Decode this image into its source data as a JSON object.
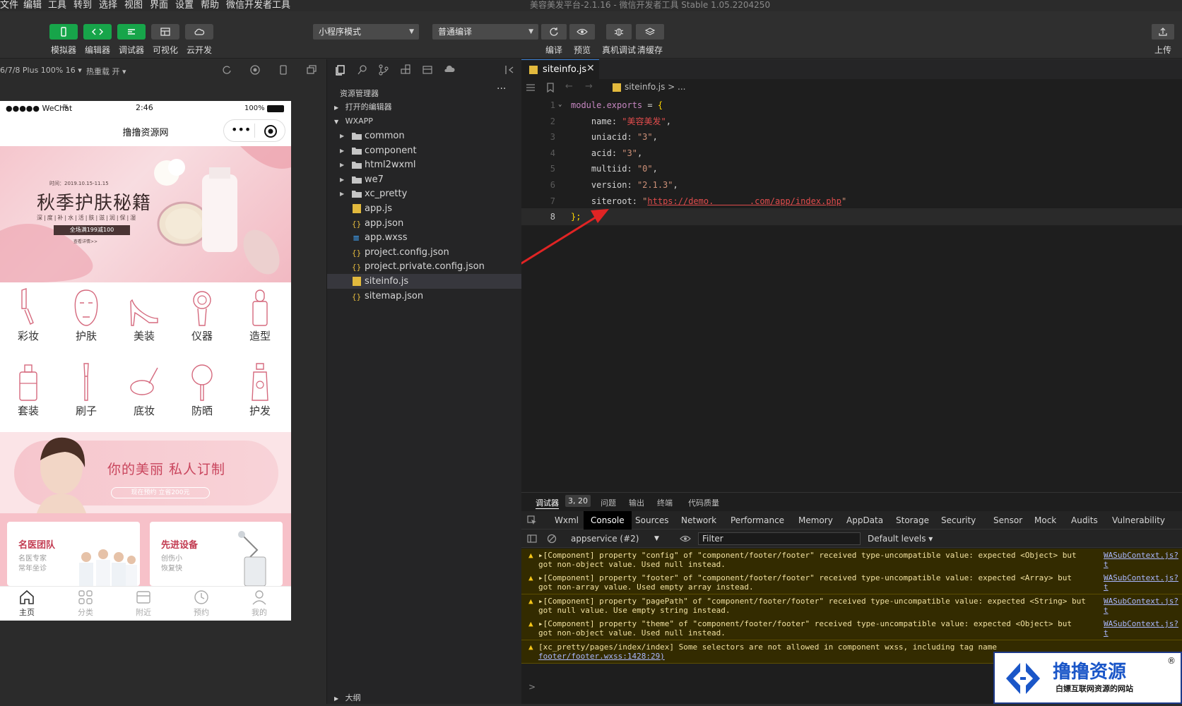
{
  "menubar": {
    "items": [
      "文件",
      "编辑",
      "工具",
      "转到",
      "选择",
      "视图",
      "界面",
      "设置",
      "帮助",
      "微信开发者工具"
    ],
    "window_title": "美容美发平台-2.1.16 - 微信开发者工具 Stable 1.05.2204250"
  },
  "toolbar": {
    "left_buttons": [
      {
        "label": "模拟器",
        "icon": "phone-icon",
        "style": "green"
      },
      {
        "label": "编辑器",
        "icon": "code-icon",
        "style": "green"
      },
      {
        "label": "调试器",
        "icon": "debug-icon",
        "style": "green"
      },
      {
        "label": "可视化",
        "icon": "layout-icon",
        "style": "gray"
      },
      {
        "label": "云开发",
        "icon": "cloud-icon",
        "style": "gray"
      }
    ],
    "mode_select": "小程序模式",
    "compile_select": "普通编译",
    "right_buttons": [
      {
        "label": "编译",
        "icon": "refresh-icon"
      },
      {
        "label": "预览",
        "icon": "eye-icon"
      },
      {
        "label": "真机调试",
        "icon": "bug-icon"
      },
      {
        "label": "清缓存",
        "icon": "layers-icon"
      }
    ],
    "upload_label": "上传"
  },
  "simulator": {
    "device": "6/7/8 Plus 100% 16 ▾",
    "hot_reload": "热重载 开 ▾",
    "status": {
      "carrier": "●●●●● WeChat",
      "time": "2:46",
      "battery": "100%"
    },
    "nav_title": "撸撸资源网",
    "banner": {
      "date": "时间：2019.10.15-11.15",
      "title": "秋季护肤秘籍",
      "subtitle": "深|度|补|水|活|肤|滋|润|保|湿",
      "promo": "全场满199减100",
      "more": "查看详情>>"
    },
    "categories": [
      {
        "label": "彩妆",
        "icon": "lipstick-icon"
      },
      {
        "label": "护肤",
        "icon": "face-mask-icon"
      },
      {
        "label": "美装",
        "icon": "high-heel-icon"
      },
      {
        "label": "仪器",
        "icon": "device-icon"
      },
      {
        "label": "造型",
        "icon": "bottle-icon"
      },
      {
        "label": "套装",
        "icon": "set-bottle-icon"
      },
      {
        "label": "刷子",
        "icon": "brush-icon"
      },
      {
        "label": "底妆",
        "icon": "compact-icon"
      },
      {
        "label": "防晒",
        "icon": "mirror-icon"
      },
      {
        "label": "护发",
        "icon": "spray-icon"
      }
    ],
    "promo": {
      "text": "你的美丽  私人订制",
      "button": "现在预约 立省200元"
    },
    "cards": [
      {
        "title": "名医团队",
        "line1": "名医专家",
        "line2": "常年坐诊"
      },
      {
        "title": "先进设备",
        "line1": "创伤小",
        "line2": "恢复快"
      }
    ],
    "tabs": [
      {
        "label": "主页",
        "icon": "home-icon",
        "active": true
      },
      {
        "label": "分类",
        "icon": "grid-icon",
        "active": false
      },
      {
        "label": "附近",
        "icon": "map-icon",
        "active": false
      },
      {
        "label": "预约",
        "icon": "clock-icon",
        "active": false
      },
      {
        "label": "我的",
        "icon": "user-icon",
        "active": false
      }
    ]
  },
  "explorer": {
    "title": "资源管理器",
    "more": "···",
    "open_editors": "打开的编辑器",
    "root": "WXAPP",
    "items": [
      {
        "name": "common",
        "type": "folder"
      },
      {
        "name": "component",
        "type": "folder"
      },
      {
        "name": "html2wxml",
        "type": "folder"
      },
      {
        "name": "we7",
        "type": "folder"
      },
      {
        "name": "xc_pretty",
        "type": "folder"
      },
      {
        "name": "app.js",
        "type": "js"
      },
      {
        "name": "app.json",
        "type": "json"
      },
      {
        "name": "app.wxss",
        "type": "css"
      },
      {
        "name": "project.config.json",
        "type": "json"
      },
      {
        "name": "project.private.config.json",
        "type": "json"
      },
      {
        "name": "siteinfo.js",
        "type": "js",
        "selected": true
      },
      {
        "name": "sitemap.json",
        "type": "json"
      }
    ],
    "bottom_section": "大纲"
  },
  "editor": {
    "tab": "siteinfo.js",
    "close": "✕",
    "breadcrumb": "siteinfo.js > ...",
    "lines": [
      {
        "n": "1",
        "pre": "",
        "key": "module.exports",
        "mid": " = ",
        "brace": "{",
        "post": ""
      },
      {
        "n": "2",
        "pre": "    ",
        "key": "name",
        "mid": ": ",
        "val": "\"美容美发\"",
        "post": ","
      },
      {
        "n": "3",
        "pre": "    ",
        "key": "uniacid",
        "mid": ": ",
        "val": "\"3\"",
        "post": ","
      },
      {
        "n": "4",
        "pre": "    ",
        "key": "acid",
        "mid": ": ",
        "val": "\"3\"",
        "post": ","
      },
      {
        "n": "5",
        "pre": "    ",
        "key": "multiid",
        "mid": ": ",
        "val": "\"0\"",
        "post": ","
      },
      {
        "n": "6",
        "pre": "    ",
        "key": "version",
        "mid": ": ",
        "val": "\"2.1.3\"",
        "post": ","
      },
      {
        "n": "7",
        "pre": "    ",
        "key": "siteroot",
        "mid": ": ",
        "url": "https://demo.       .com/app/index.php",
        "post": "\""
      },
      {
        "n": "8",
        "pre": "",
        "key": "",
        "mid": "",
        "brace": "};",
        "post": ""
      }
    ]
  },
  "console": {
    "panel_tabs": [
      "调试器",
      "问题",
      "输出",
      "终端",
      "代码质量"
    ],
    "badge": "3, 20",
    "devtools_tabs": [
      "Wxml",
      "Console",
      "Sources",
      "Network",
      "Performance",
      "Memory",
      "AppData",
      "Storage",
      "Security",
      "Sensor",
      "Mock",
      "Audits",
      "Vulnerability"
    ],
    "active_tab": "Console",
    "context": "appservice (#2)",
    "filter_placeholder": "Filter",
    "levels": "Default levels ▾",
    "messages": [
      {
        "text": "▸[Component] property \"config\" of \"component/footer/footer\" received type-uncompatible value: expected <Object> but got non-object value. Used null instead.",
        "src": "WASubContext.js?t"
      },
      {
        "text": "▸[Component] property \"footer\" of \"component/footer/footer\" received type-uncompatible value: expected <Array> but got non-array value. Used empty array instead.",
        "src": "WASubContext.js?t"
      },
      {
        "text": "▸[Component] property \"pagePath\" of \"component/footer/footer\" received type-uncompatible value: expected <String> but got null value. Use empty string instead.",
        "src": "WASubContext.js?t"
      },
      {
        "text": "▸[Component] property \"theme\" of \"component/footer/footer\" received type-uncompatible value: expected <Object> but got non-object value. Used null instead.",
        "src": "WASubContext.js?t"
      },
      {
        "text": "[xc_pretty/pages/index/index] Some selectors are not allowed in component wxss, including tag name",
        "src": "",
        "src2": "footer/footer.wxss:1428:29)"
      }
    ],
    "prompt": ">"
  },
  "watermark": {
    "title": "撸撸资源",
    "subtitle": "白嫖互联网资源的网站",
    "reg": "®"
  }
}
